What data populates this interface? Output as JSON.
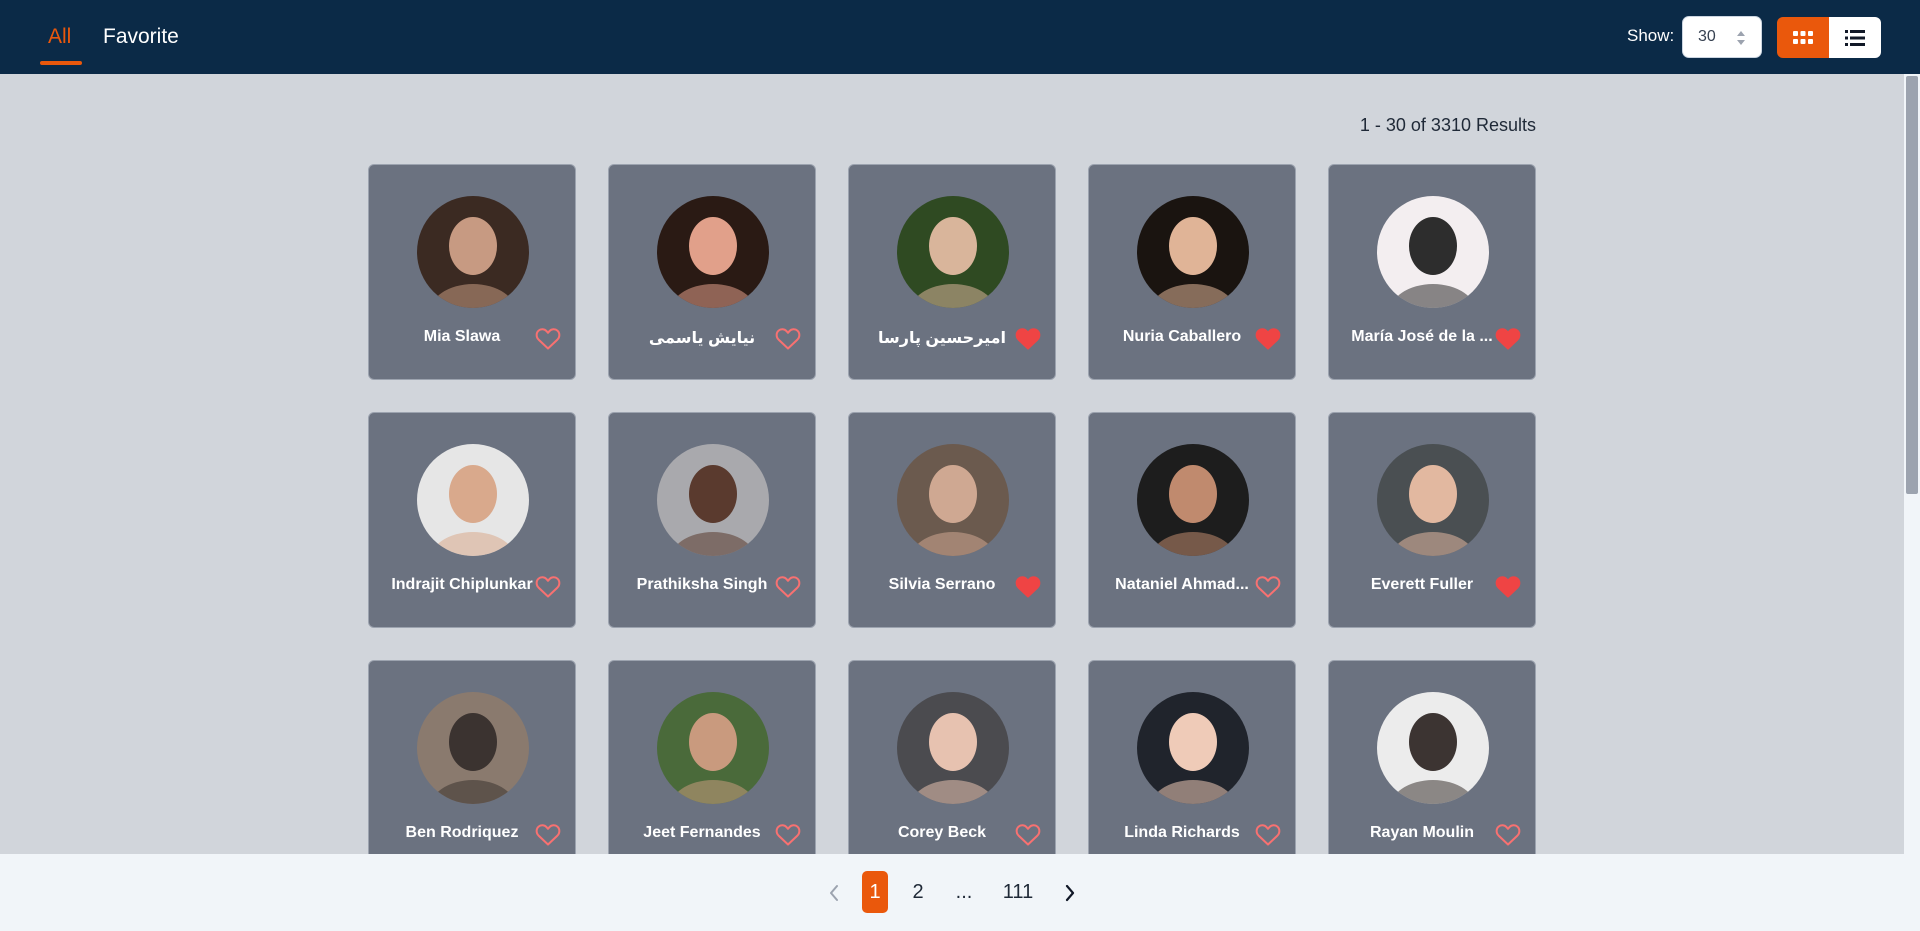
{
  "tabs": [
    {
      "label": "All",
      "active": true
    },
    {
      "label": "Favorite",
      "active": false
    }
  ],
  "show": {
    "label": "Show:",
    "value": "30"
  },
  "view_modes": [
    {
      "icon": "grid-icon",
      "active": true
    },
    {
      "icon": "list-icon",
      "active": false
    }
  ],
  "results_text": "1 - 30 of 3310 Results",
  "people": [
    {
      "name": "Mia Slawa",
      "favorite": false
    },
    {
      "name": "نیایش یاسمی",
      "favorite": false
    },
    {
      "name": "امیرحسین پارسا",
      "favorite": true
    },
    {
      "name": "Nuria Caballero",
      "favorite": true
    },
    {
      "name": "María José de la ...",
      "favorite": true
    },
    {
      "name": "Indrajit Chiplunkar",
      "favorite": false
    },
    {
      "name": "Prathiksha Singh",
      "favorite": false
    },
    {
      "name": "Silvia Serrano",
      "favorite": true
    },
    {
      "name": "Nataniel Ahmad...",
      "favorite": false
    },
    {
      "name": "Everett Fuller",
      "favorite": true
    },
    {
      "name": "Ben Rodriquez",
      "favorite": false
    },
    {
      "name": "Jeet Fernandes",
      "favorite": false
    },
    {
      "name": "Corey Beck",
      "favorite": false
    },
    {
      "name": "Linda Richards",
      "favorite": false
    },
    {
      "name": "Rayan Moulin",
      "favorite": false
    }
  ],
  "pagination": {
    "pages": [
      "1",
      "2",
      "...",
      "111"
    ],
    "current": "1",
    "prev_icon": "chevron-left-icon",
    "next_icon": "chevron-right-icon"
  },
  "colors": {
    "accent": "#ea580c",
    "header_bg": "#0b2a47",
    "page_bg": "#d1d5db",
    "card_bg": "#6b7280",
    "heart_filled": "#ef4444",
    "heart_outline": "#f87171"
  }
}
